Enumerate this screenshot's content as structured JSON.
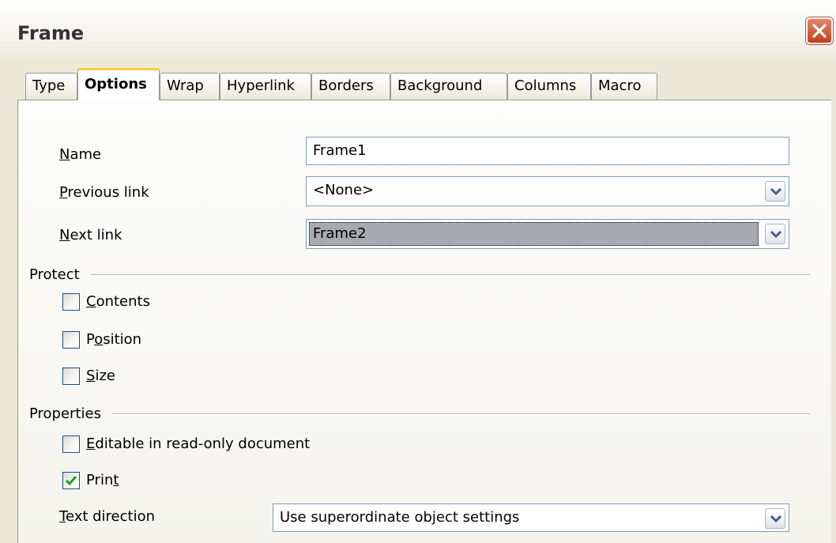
{
  "window": {
    "title": "Frame",
    "close_icon": "close-icon"
  },
  "tabs": [
    {
      "label": "Type",
      "active": false
    },
    {
      "label": "Options",
      "active": true
    },
    {
      "label": "Wrap",
      "active": false
    },
    {
      "label": "Hyperlink",
      "active": false
    },
    {
      "label": "Borders",
      "active": false
    },
    {
      "label": "Background",
      "active": false
    },
    {
      "label": "Columns",
      "active": false
    },
    {
      "label": "Macro",
      "active": false
    }
  ],
  "form": {
    "name_label": "Name",
    "name_value": "Frame1",
    "previous_link_label": "Previous link",
    "previous_link_value": "<None>",
    "next_link_label": "Next link",
    "next_link_value": "Frame2"
  },
  "protect": {
    "title": "Protect",
    "contents": {
      "label": "Contents",
      "checked": false
    },
    "position": {
      "label": "Position",
      "checked": false
    },
    "size": {
      "label": "Size",
      "checked": false
    }
  },
  "properties": {
    "title": "Properties",
    "editable": {
      "label": "Editable in read-only document",
      "checked": false
    },
    "print": {
      "label": "Print",
      "checked": true
    },
    "text_direction_label": "Text direction",
    "text_direction_value": "Use superordinate object settings"
  },
  "colors": {
    "accent_tab": "#ffc83c",
    "checkmark": "#21a121",
    "close": "#c13e1c"
  }
}
